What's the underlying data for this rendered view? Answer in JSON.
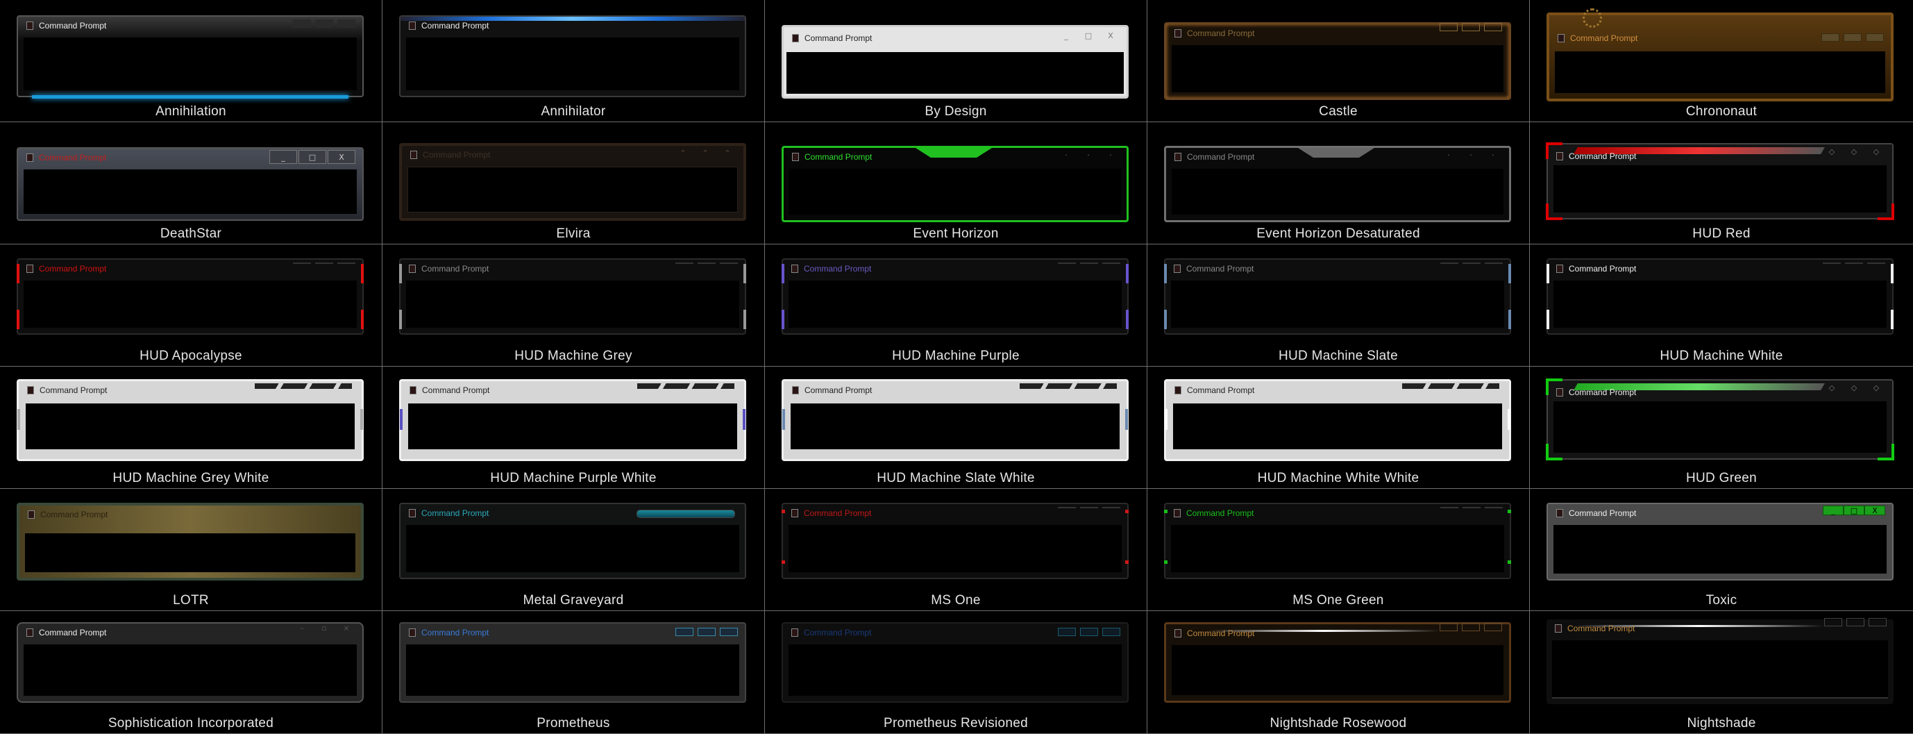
{
  "window_title": "Command Prompt",
  "themes": [
    "Annihilation",
    "Annihilator",
    "By Design",
    "Castle",
    "Chrononaut",
    "DeathStar",
    "Elvira",
    "Event Horizon",
    "Event Horizon Desaturated",
    "HUD Red",
    "HUD Apocalypse",
    "HUD Machine Grey",
    "HUD Machine Purple",
    "HUD Machine Slate",
    "HUD Machine White",
    "HUD Machine Grey White",
    "HUD Machine Purple White",
    "HUD Machine Slate White",
    "HUD Machine White White",
    "HUD Green",
    "LOTR",
    "Metal Graveyard",
    "MS One",
    "MS One Green",
    "Toxic",
    "Sophistication Incorporated",
    "Prometheus",
    "Prometheus Revisioned",
    "Nightshade Rosewood",
    "Nightshade"
  ],
  "controls": {
    "minimize": "_",
    "maximize": "□",
    "close": "X"
  },
  "colors": {
    "background": "#000000",
    "grid_line": "#6e6e6e",
    "caption": "#e6e6e6",
    "accent_blue": "#1fb2ff",
    "accent_green": "#1fc01f",
    "accent_red": "#d01010"
  }
}
